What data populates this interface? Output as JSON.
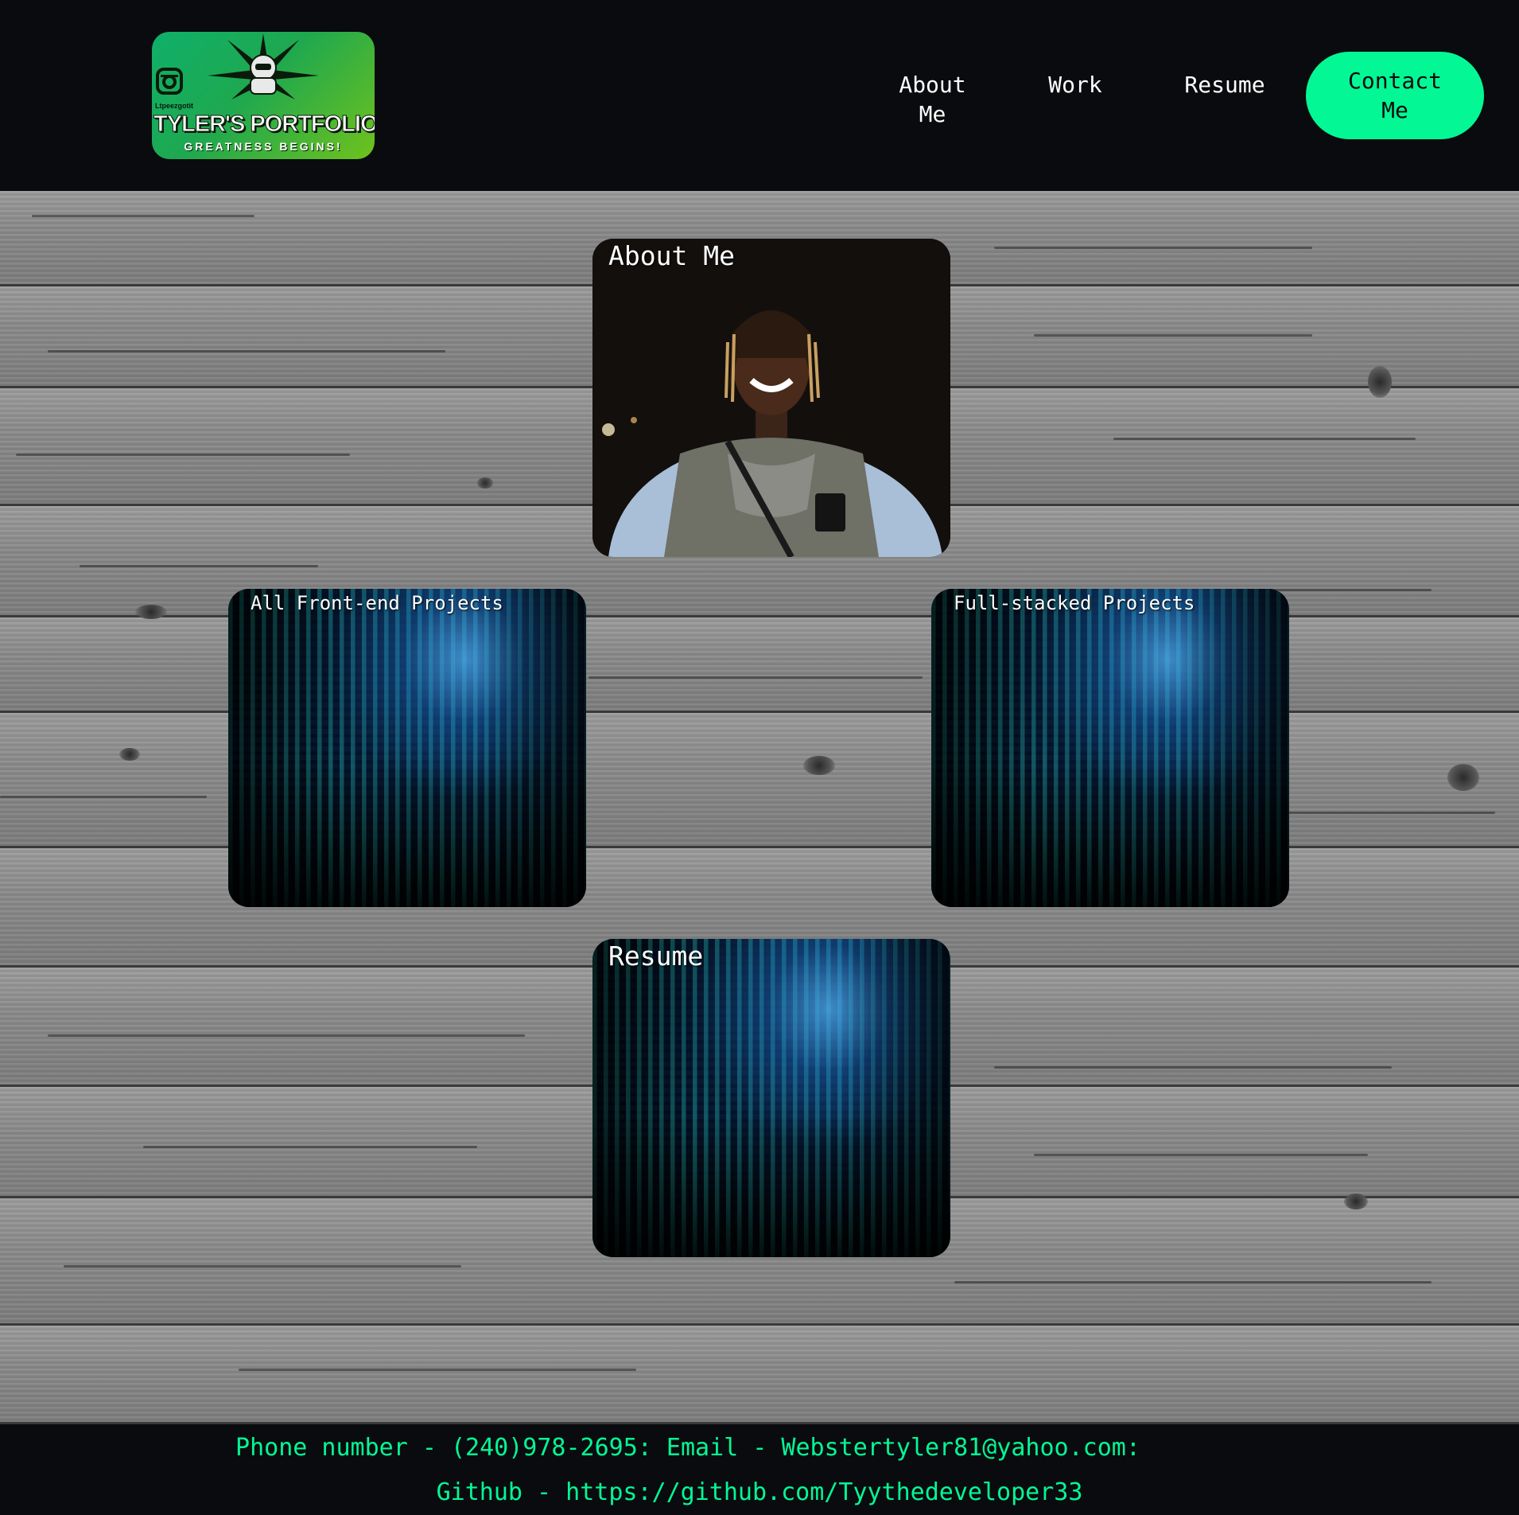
{
  "header": {
    "logo": {
      "tag": "Ltpeezgotit",
      "title": "TYLER'S PORTFOLIO",
      "subtitle": "GREATNESS BEGINS!"
    },
    "nav": {
      "about_label": "About Me",
      "work_label": "Work",
      "resume_label": "Resume",
      "contact_label": "Contact Me"
    }
  },
  "cards": {
    "about": {
      "title": "About Me",
      "image": "profile-photo"
    },
    "frontend": {
      "title": "All Front-end Projects",
      "image": "binary-code-matrix"
    },
    "fullstack": {
      "title": "Full-stacked Projects",
      "image": "binary-code-matrix"
    },
    "resume": {
      "title": "Resume",
      "image": "binary-code-matrix"
    }
  },
  "footer": {
    "line1": "Phone number - (240)978-2695: Email - Webstertyler81@yahoo.com:",
    "line2": "Github - https://github.com/Tyythedeveloper33"
  },
  "colors": {
    "accent": "#03f895",
    "header_bg": "#0a0b0e",
    "logo_green": "#1fa84f"
  }
}
